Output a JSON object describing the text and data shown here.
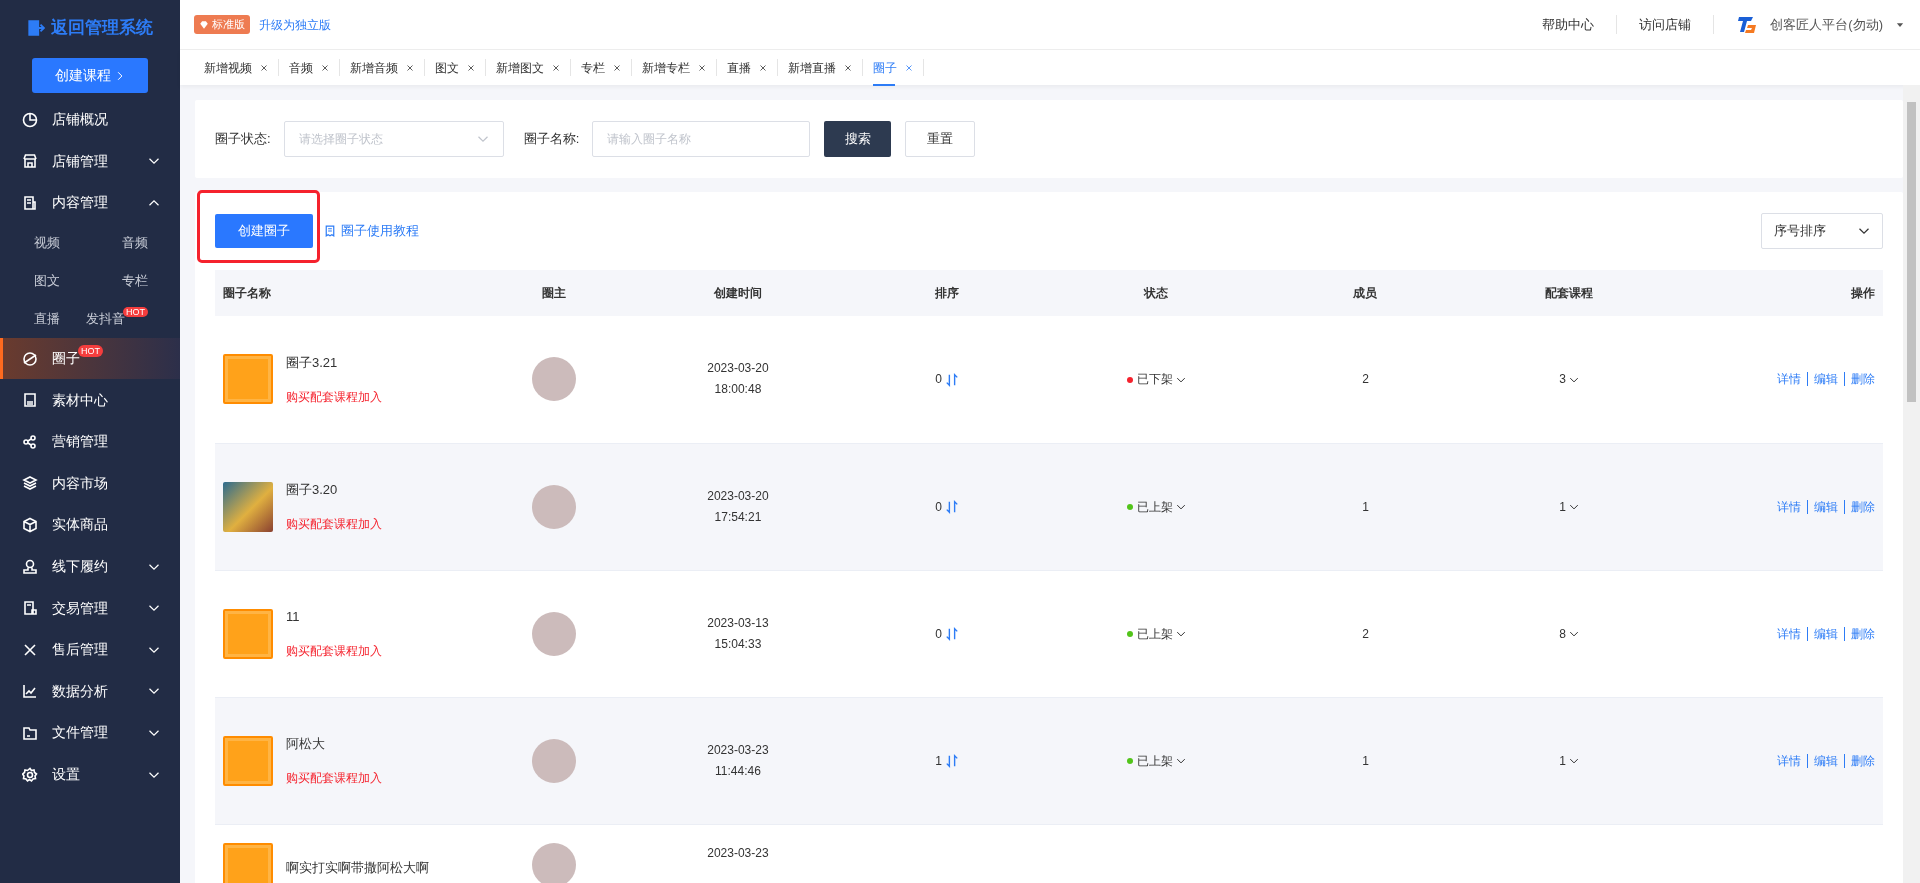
{
  "sidebar": {
    "logo_text": "返回管理系统",
    "create_button": "创建课程",
    "items": [
      {
        "label": "店铺概况",
        "selected": false
      },
      {
        "label": "店铺管理",
        "expanded": false,
        "selected": false
      },
      {
        "label": "内容管理",
        "expanded": true,
        "selected": false,
        "children": [
          {
            "label": "视频"
          },
          {
            "label": "音频"
          },
          {
            "label": "图文"
          },
          {
            "label": "专栏"
          },
          {
            "label": "直播"
          },
          {
            "label": "发抖音",
            "badge": "HOT"
          }
        ]
      },
      {
        "label": "圈子",
        "badge": "HOT",
        "selected": true
      },
      {
        "label": "素材中心",
        "selected": false
      },
      {
        "label": "营销管理",
        "selected": false
      },
      {
        "label": "内容市场",
        "selected": false
      },
      {
        "label": "实体商品",
        "selected": false
      },
      {
        "label": "线下履约",
        "expanded": false,
        "selected": false
      },
      {
        "label": "交易管理",
        "expanded": false,
        "selected": false
      },
      {
        "label": "售后管理",
        "expanded": false,
        "selected": false
      },
      {
        "label": "数据分析",
        "expanded": false,
        "selected": false
      },
      {
        "label": "文件管理",
        "expanded": false,
        "selected": false
      },
      {
        "label": "设置",
        "expanded": false,
        "selected": false
      }
    ]
  },
  "header": {
    "edition_badge": "标准版",
    "upgrade_link": "升级为独立版",
    "links": [
      "帮助中心",
      "访问店铺"
    ],
    "user": "创客匠人平台(勿动)"
  },
  "tabs": [
    {
      "label": "新增视频",
      "selected": false
    },
    {
      "label": "音频",
      "selected": false
    },
    {
      "label": "新增音频",
      "selected": false
    },
    {
      "label": "图文",
      "selected": false
    },
    {
      "label": "新增图文",
      "selected": false
    },
    {
      "label": "专栏",
      "selected": false
    },
    {
      "label": "新增专栏",
      "selected": false
    },
    {
      "label": "直播",
      "selected": false
    },
    {
      "label": "新增直播",
      "selected": false
    },
    {
      "label": "圈子",
      "selected": true
    }
  ],
  "filters": {
    "status_label": "圈子状态:",
    "status_placeholder": "请选择圈子状态",
    "name_label": "圈子名称:",
    "name_placeholder": "请输入圈子名称",
    "search_button": "搜索",
    "reset_button": "重置"
  },
  "toolbar": {
    "create_button": "创建圈子",
    "highlighted": true,
    "tutorial_link": "圈子使用教程",
    "sort_select": "序号排序"
  },
  "table": {
    "columns": [
      "圈子名称",
      "圈主",
      "创建时间",
      "排序",
      "状态",
      "成员",
      "配套课程",
      "操作"
    ],
    "rows": [
      {
        "kind": "coupon",
        "name": "圈子3.21",
        "note": "购买配套课程加入",
        "date": "2023-03-20",
        "time": "18:00:48",
        "order": "0",
        "status": "已下架",
        "color": "#f5222d",
        "members": "2",
        "courses": "3",
        "actions": [
          "详情",
          "编辑",
          "删除"
        ]
      },
      {
        "kind": "photo",
        "name": "圈子3.20",
        "note": "购买配套课程加入",
        "date": "2023-03-20",
        "time": "17:54:21",
        "order": "0",
        "status": "已上架",
        "color": "#52c41a",
        "members": "1",
        "courses": "1",
        "actions": [
          "详情",
          "编辑",
          "删除"
        ]
      },
      {
        "kind": "coupon",
        "name": "11",
        "note": "购买配套课程加入",
        "date": "2023-03-13",
        "time": "15:04:33",
        "order": "0",
        "status": "已上架",
        "color": "#52c41a",
        "members": "2",
        "courses": "8",
        "actions": [
          "详情",
          "编辑",
          "删除"
        ]
      },
      {
        "kind": "coupon",
        "name": "阿松大",
        "note": "购买配套课程加入",
        "date": "2023-03-23",
        "time": "11:44:46",
        "order": "1",
        "status": "已上架",
        "color": "#52c41a",
        "members": "1",
        "courses": "1",
        "actions": [
          "详情",
          "编辑",
          "删除"
        ]
      },
      {
        "kind": "coupon",
        "name": "啊实打实啊带撒阿松大啊",
        "date": "2023-03-23"
      }
    ]
  }
}
